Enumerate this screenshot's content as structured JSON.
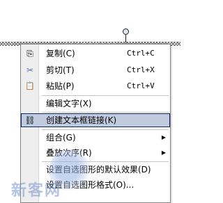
{
  "menu": {
    "items": [
      {
        "label": "复制(C)",
        "shortcut": "Ctrl+C",
        "icon": "copy-icon",
        "glyph": "⎘"
      },
      {
        "label": "剪切(T)",
        "shortcut": "Ctrl+X",
        "icon": "scissors-icon",
        "glyph": "✂"
      },
      {
        "label": "粘贴(P)",
        "shortcut": "Ctrl+V",
        "icon": "paste-icon",
        "glyph": "📋"
      },
      {
        "label": "编辑文字(X)"
      },
      {
        "label": "创建文本框链接(K)",
        "icon": "link-icon",
        "glyph": "⛓",
        "highlighted": true
      },
      {
        "label": "组合(G)",
        "submenu": true
      },
      {
        "label": "叠放次序(R)",
        "submenu": true
      },
      {
        "label": "设置自选图形的默认效果(D)"
      },
      {
        "label": "设置自选图形格式(O)..."
      }
    ],
    "submenu_arrow": "▶"
  },
  "watermark": {
    "text": "新客网"
  },
  "colors": {
    "highlight_bg": "#c0cbe0",
    "highlight_border": "#0a246a",
    "gutter": "#eeeeee"
  }
}
